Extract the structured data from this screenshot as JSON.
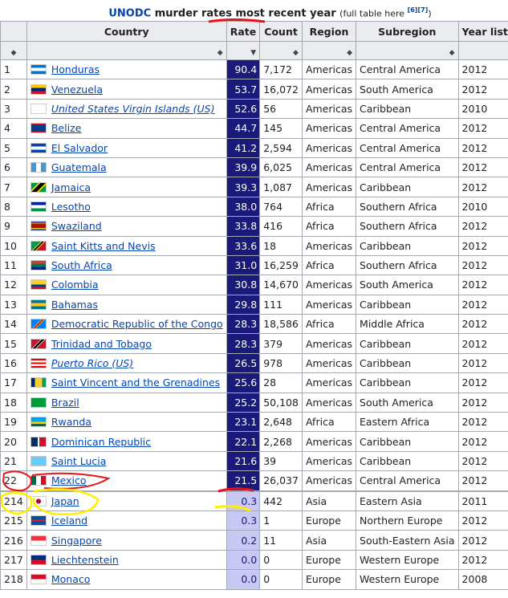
{
  "caption": {
    "link": "UNODC",
    "text": " murder rates most recent year ",
    "small": "(full table here ",
    "refs": "[6][7]",
    "close": ")"
  },
  "headers": [
    "Country",
    "Rate",
    "Count",
    "Region",
    "Subregion",
    "Year listed"
  ],
  "rows": [
    {
      "n": "1",
      "country": "Honduras",
      "rate": "90.4",
      "count": "7,172",
      "region": "Americas",
      "sub": "Central America",
      "year": "2012",
      "flag": "hn"
    },
    {
      "n": "2",
      "country": "Venezuela",
      "rate": "53.7",
      "count": "16,072",
      "region": "Americas",
      "sub": "South America",
      "year": "2012",
      "flag": "ve"
    },
    {
      "n": "3",
      "country": "United States Virgin Islands (US)",
      "rate": "52.6",
      "count": "56",
      "region": "Americas",
      "sub": "Caribbean",
      "year": "2010",
      "flag": "vi",
      "italic": true
    },
    {
      "n": "4",
      "country": "Belize",
      "rate": "44.7",
      "count": "145",
      "region": "Americas",
      "sub": "Central America",
      "year": "2012",
      "flag": "bz"
    },
    {
      "n": "5",
      "country": "El Salvador",
      "rate": "41.2",
      "count": "2,594",
      "region": "Americas",
      "sub": "Central America",
      "year": "2012",
      "flag": "sv"
    },
    {
      "n": "6",
      "country": "Guatemala",
      "rate": "39.9",
      "count": "6,025",
      "region": "Americas",
      "sub": "Central America",
      "year": "2012",
      "flag": "gt"
    },
    {
      "n": "7",
      "country": "Jamaica",
      "rate": "39.3",
      "count": "1,087",
      "region": "Americas",
      "sub": "Caribbean",
      "year": "2012",
      "flag": "jm"
    },
    {
      "n": "8",
      "country": "Lesotho",
      "rate": "38.0",
      "count": "764",
      "region": "Africa",
      "sub": "Southern Africa",
      "year": "2010",
      "flag": "ls"
    },
    {
      "n": "9",
      "country": "Swaziland",
      "rate": "33.8",
      "count": "416",
      "region": "Africa",
      "sub": "Southern Africa",
      "year": "2012",
      "flag": "sz"
    },
    {
      "n": "10",
      "country": "Saint Kitts and Nevis",
      "rate": "33.6",
      "count": "18",
      "region": "Americas",
      "sub": "Caribbean",
      "year": "2012",
      "flag": "kn"
    },
    {
      "n": "11",
      "country": "South Africa",
      "rate": "31.0",
      "count": "16,259",
      "region": "Africa",
      "sub": "Southern Africa",
      "year": "2012",
      "flag": "za"
    },
    {
      "n": "12",
      "country": "Colombia",
      "rate": "30.8",
      "count": "14,670",
      "region": "Americas",
      "sub": "South America",
      "year": "2012",
      "flag": "co"
    },
    {
      "n": "13",
      "country": "Bahamas",
      "rate": "29.8",
      "count": "111",
      "region": "Americas",
      "sub": "Caribbean",
      "year": "2012",
      "flag": "bs"
    },
    {
      "n": "14",
      "country": "Democratic Republic of the Congo",
      "rate": "28.3",
      "count": "18,586",
      "region": "Africa",
      "sub": "Middle Africa",
      "year": "2012",
      "flag": "cd"
    },
    {
      "n": "15",
      "country": "Trinidad and Tobago",
      "rate": "28.3",
      "count": "379",
      "region": "Americas",
      "sub": "Caribbean",
      "year": "2012",
      "flag": "tt"
    },
    {
      "n": "16",
      "country": "Puerto Rico (US)",
      "rate": "26.5",
      "count": "978",
      "region": "Americas",
      "sub": "Caribbean",
      "year": "2012",
      "flag": "pr",
      "italic": true
    },
    {
      "n": "17",
      "country": "Saint Vincent and the Grenadines",
      "rate": "25.6",
      "count": "28",
      "region": "Americas",
      "sub": "Caribbean",
      "year": "2012",
      "flag": "vc"
    },
    {
      "n": "18",
      "country": "Brazil",
      "rate": "25.2",
      "count": "50,108",
      "region": "Americas",
      "sub": "South America",
      "year": "2012",
      "flag": "br"
    },
    {
      "n": "19",
      "country": "Rwanda",
      "rate": "23.1",
      "count": "2,648",
      "region": "Africa",
      "sub": "Eastern Africa",
      "year": "2012",
      "flag": "rw"
    },
    {
      "n": "20",
      "country": "Dominican Republic",
      "rate": "22.1",
      "count": "2,268",
      "region": "Americas",
      "sub": "Caribbean",
      "year": "2012",
      "flag": "do"
    },
    {
      "n": "21",
      "country": "Saint Lucia",
      "rate": "21.6",
      "count": "39",
      "region": "Americas",
      "sub": "Caribbean",
      "year": "2012",
      "flag": "lc"
    },
    {
      "n": "22",
      "country": "Mexico",
      "rate": "21.5",
      "count": "26,037",
      "region": "Americas",
      "sub": "Central America",
      "year": "2012",
      "flag": "mx"
    },
    {
      "n": "214",
      "country": "Japan",
      "rate": "0.3",
      "count": "442",
      "region": "Asia",
      "sub": "Eastern Asia",
      "year": "2011",
      "flag": "jp",
      "low": true
    },
    {
      "n": "215",
      "country": "Iceland",
      "rate": "0.3",
      "count": "1",
      "region": "Europe",
      "sub": "Northern Europe",
      "year": "2012",
      "flag": "is",
      "low": true
    },
    {
      "n": "216",
      "country": "Singapore",
      "rate": "0.2",
      "count": "11",
      "region": "Asia",
      "sub": "South-Eastern Asia",
      "year": "2012",
      "flag": "sg",
      "low": true
    },
    {
      "n": "217",
      "country": "Liechtenstein",
      "rate": "0.0",
      "count": "0",
      "region": "Europe",
      "sub": "Western Europe",
      "year": "2012",
      "flag": "li",
      "low": true
    },
    {
      "n": "218",
      "country": "Monaco",
      "rate": "0.0",
      "count": "0",
      "region": "Europe",
      "sub": "Western Europe",
      "year": "2008",
      "flag": "mc",
      "low": true
    }
  ],
  "colors": {
    "rate_high": "#1a1a7a",
    "rate_low": "#c8c8f4",
    "link": "#0645ad",
    "annotation_red": "#e8141b",
    "annotation_yellow": "#ffee00"
  }
}
